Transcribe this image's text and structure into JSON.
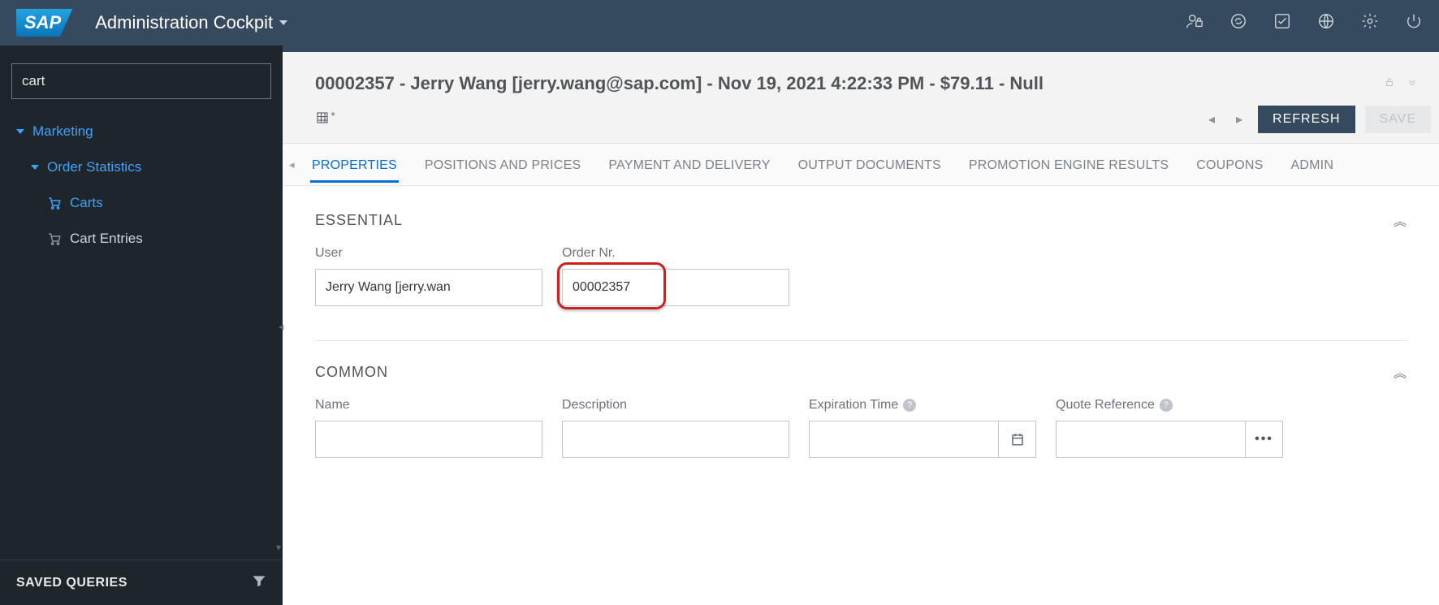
{
  "header": {
    "logo_text": "SAP",
    "app_title": "Administration Cockpit"
  },
  "sidebar": {
    "search_value": "cart",
    "tree": {
      "lvl0": "Marketing",
      "lvl1": "Order Statistics",
      "carts": "Carts",
      "cart_entries": "Cart Entries"
    },
    "saved_queries_label": "SAVED QUERIES"
  },
  "record": {
    "title": "00002357 - Jerry Wang [jerry.wang@sap.com] - Nov 19, 2021 4:22:33 PM - $79.11 - Null"
  },
  "toolbar": {
    "refresh_label": "REFRESH",
    "save_label": "SAVE"
  },
  "tabs": {
    "properties": "PROPERTIES",
    "positions": "POSITIONS AND PRICES",
    "payment": "PAYMENT AND DELIVERY",
    "output": "OUTPUT DOCUMENTS",
    "promotion": "PROMOTION ENGINE RESULTS",
    "coupons": "COUPONS",
    "admin": "ADMIN"
  },
  "sections": {
    "essential": {
      "heading": "ESSENTIAL",
      "user_label": "User",
      "user_value": "Jerry Wang [jerry.wan",
      "order_label": "Order Nr.",
      "order_value": "00002357"
    },
    "common": {
      "heading": "COMMON",
      "name_label": "Name",
      "name_value": "",
      "desc_label": "Description",
      "desc_value": "",
      "exp_label": "Expiration Time",
      "exp_value": "",
      "quote_label": "Quote Reference",
      "quote_value": ""
    }
  }
}
